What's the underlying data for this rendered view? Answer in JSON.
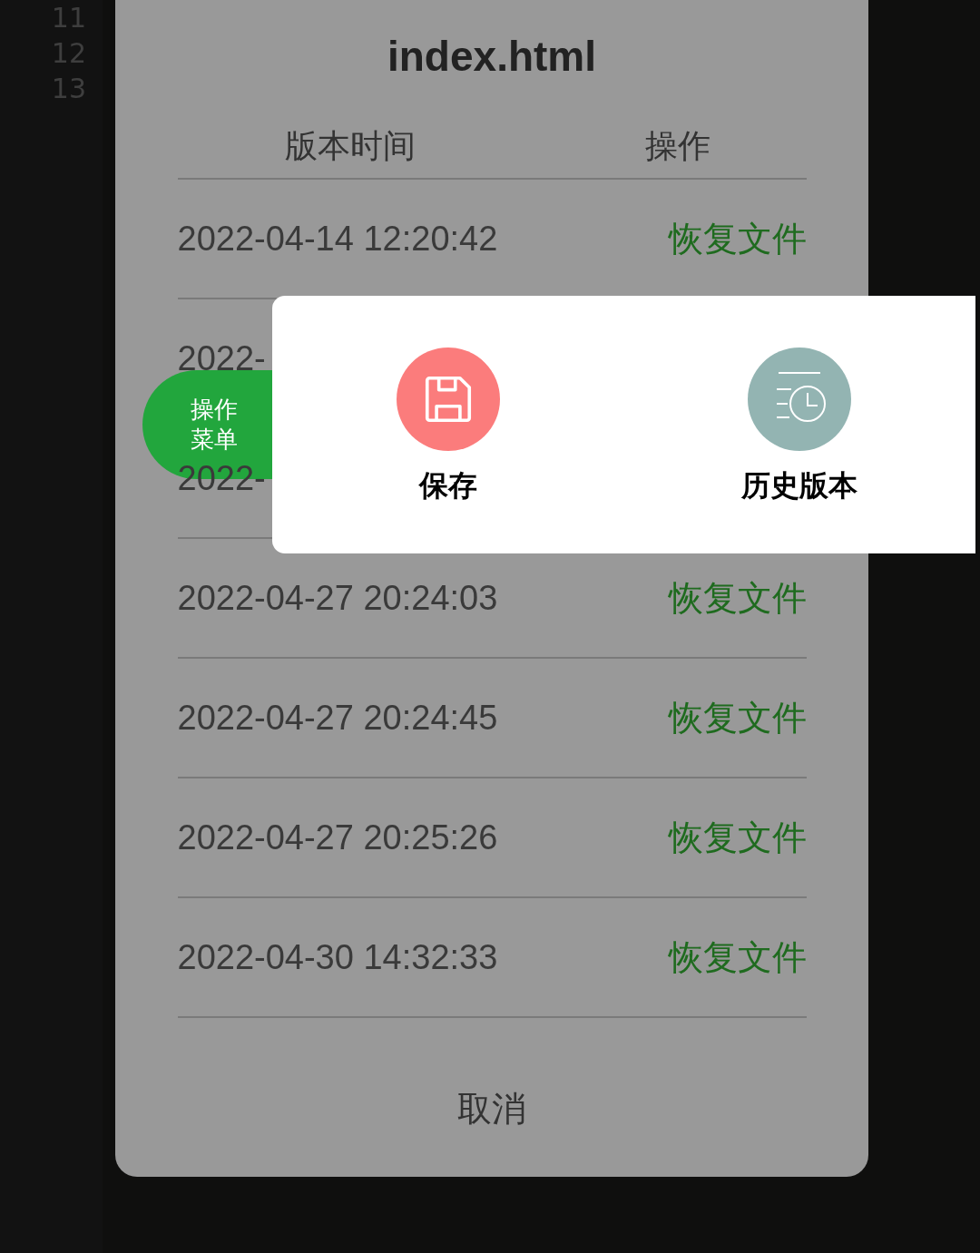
{
  "editor": {
    "line_numbers": [
      "11",
      "12",
      "13"
    ]
  },
  "dialog": {
    "title": "index.html",
    "columns": [
      "版本时间",
      "操作"
    ],
    "rows": [
      {
        "time": "2022-04-14 12:20:42",
        "action": "恢复文件"
      },
      {
        "time": "2022-"
      },
      {
        "time": "2022-"
      },
      {
        "time": "2022-04-27 20:24:03",
        "action": "恢复文件"
      },
      {
        "time": "2022-04-27 20:24:45",
        "action": "恢复文件"
      },
      {
        "time": "2022-04-27 20:25:26",
        "action": "恢复文件"
      },
      {
        "time": "2022-04-30 14:32:33",
        "action": "恢复文件"
      }
    ],
    "cancel": "取消"
  },
  "floating_button": {
    "label_lines": [
      "操作",
      "菜单"
    ]
  },
  "menu": {
    "items": [
      {
        "kind": "save",
        "label": "保存"
      },
      {
        "kind": "history",
        "label": "历史版本"
      }
    ]
  }
}
